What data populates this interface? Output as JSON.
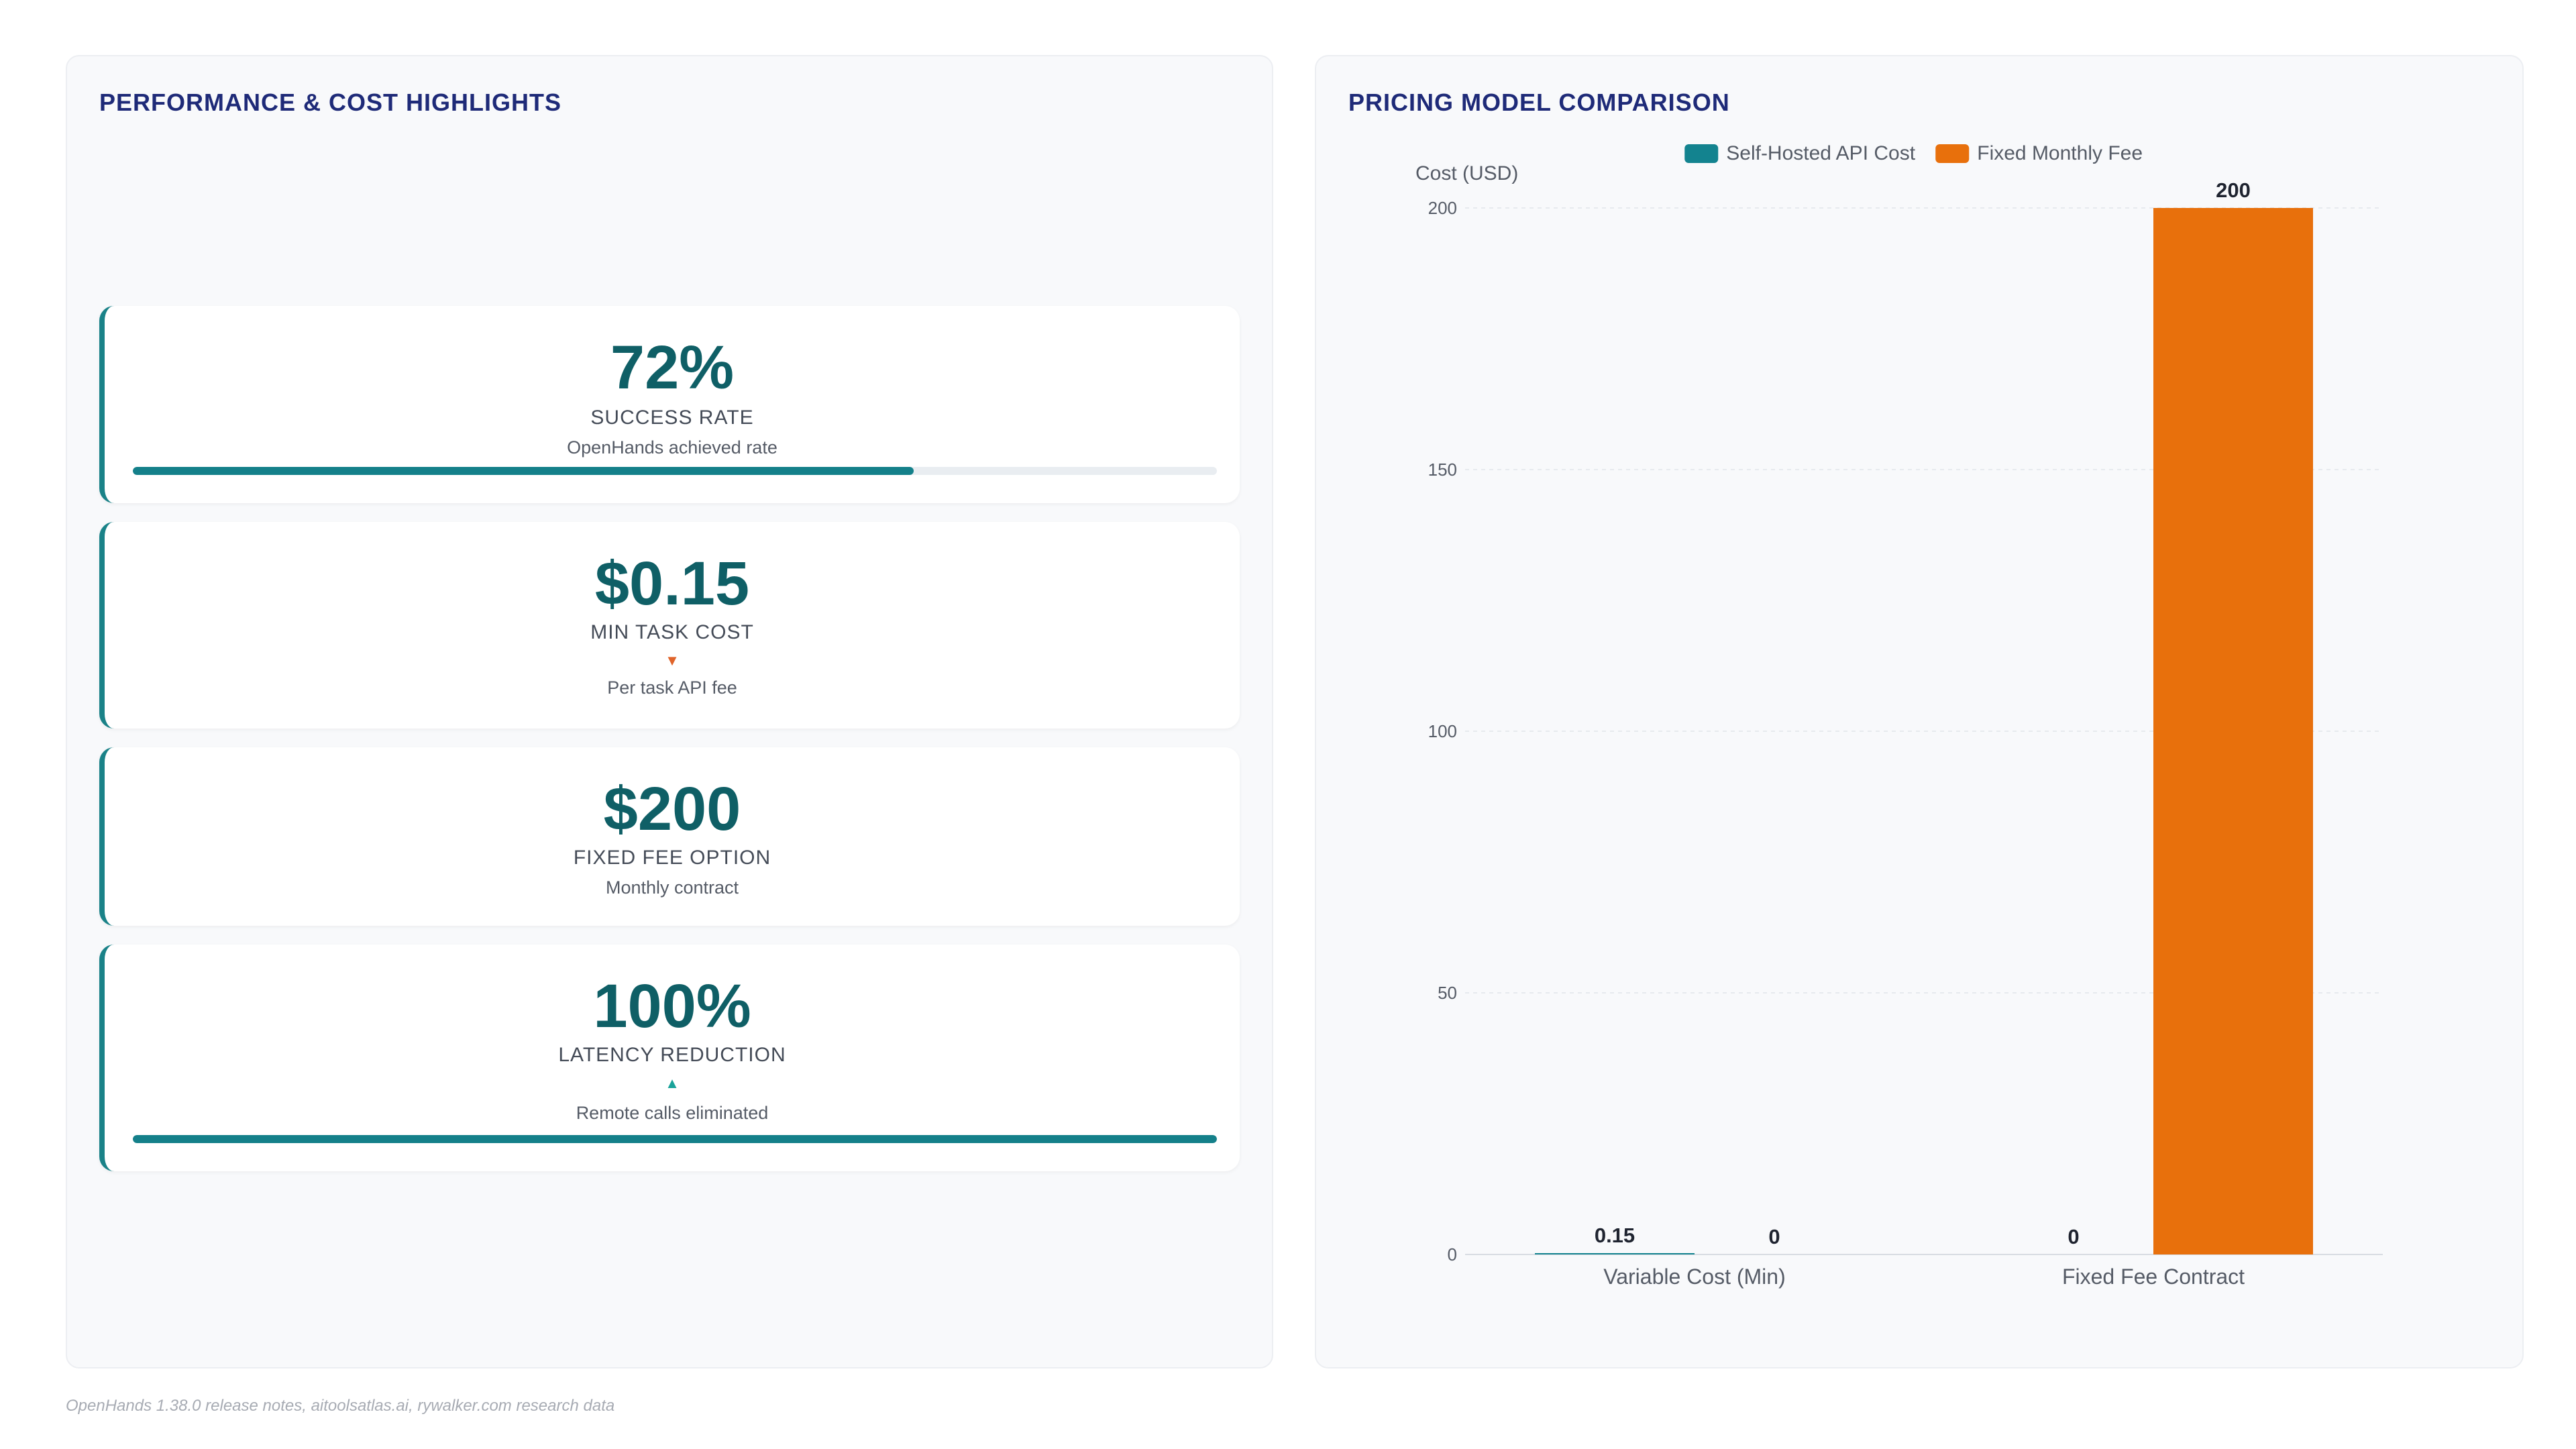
{
  "left_panel": {
    "title": "PERFORMANCE & COST HIGHLIGHTS",
    "kpis": [
      {
        "value": "72%",
        "label": "SUCCESS RATE",
        "trend": "",
        "sub": "OpenHands achieved rate",
        "progress": 0.72
      },
      {
        "value": "$0.15",
        "label": "MIN TASK COST",
        "trend": "▼",
        "trend_color": "#e0642a",
        "sub": "Per task API fee",
        "progress": null
      },
      {
        "value": "$200",
        "label": "FIXED FEE OPTION",
        "trend": "",
        "sub": "Monthly contract",
        "progress": null
      },
      {
        "value": "100%",
        "label": "LATENCY REDUCTION",
        "trend": "▲",
        "trend_color": "#1aa39a",
        "sub": "Remote calls eliminated",
        "progress": 1.0
      }
    ]
  },
  "right_panel": {
    "title": "PRICING MODEL COMPARISON"
  },
  "chart_data": {
    "type": "bar",
    "title": "",
    "xlabel": "",
    "ylabel": "Cost (USD)",
    "categories": [
      "Variable Cost (Min)",
      "Fixed Fee Contract"
    ],
    "series": [
      {
        "name": "Self-Hosted API Cost",
        "values": [
          0.15,
          0
        ],
        "color": "#13838f"
      },
      {
        "name": "Fixed Monthly Fee",
        "values": [
          0,
          200
        ],
        "color": "#e8700c"
      }
    ],
    "ylim": [
      0,
      200
    ],
    "yticks": [
      0,
      50,
      100,
      150,
      200
    ],
    "legend": "top-center",
    "grid": true,
    "data_labels": true
  },
  "footer": "OpenHands 1.38.0 release notes, aitoolsatlas.ai, rywalker.com research data"
}
